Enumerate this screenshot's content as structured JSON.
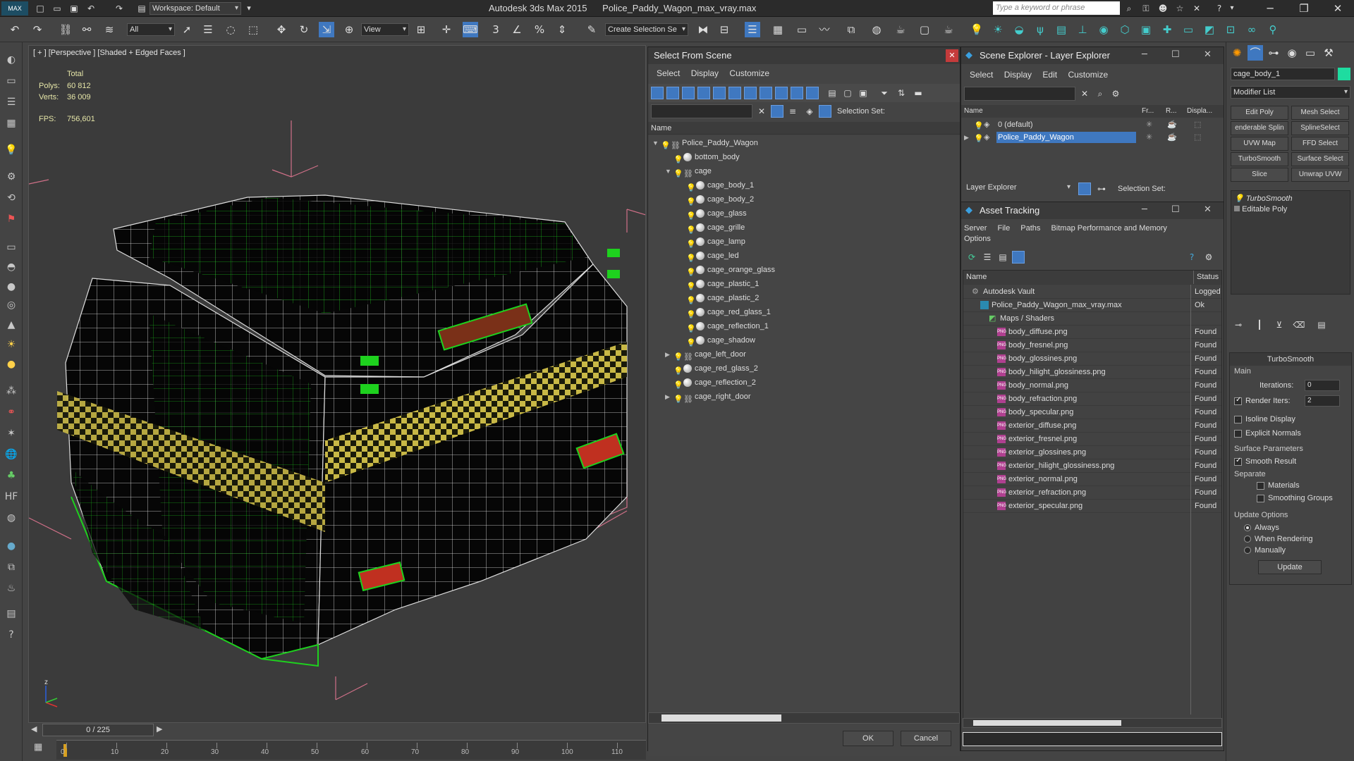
{
  "app": {
    "title": "Autodesk 3ds Max  2015",
    "file": "Police_Paddy_Wagon_max_vray.max",
    "workspace": "Workspace: Default",
    "search_placeholder": "Type a keyword or phrase",
    "logo": "MAX"
  },
  "toolbar": {
    "filter": "All",
    "ref_coord": "View",
    "selection_set": "Create Selection Se",
    "snap_3": "3",
    "snap_pct": "%"
  },
  "viewport": {
    "label": "[ + ] [Perspective ] [Shaded + Edged Faces ]",
    "stats_header": "Total",
    "polys_label": "Polys:",
    "polys_value": "60 812",
    "verts_label": "Verts:",
    "verts_value": "36 009",
    "fps_label": "FPS:",
    "fps_value": "756,601",
    "axis_z": "z"
  },
  "timeline": {
    "frame": "0 / 225",
    "ticks": [
      "0",
      "10",
      "20",
      "30",
      "40",
      "50",
      "60",
      "70",
      "80",
      "90",
      "100",
      "110"
    ]
  },
  "select_from_scene": {
    "title": "Select From Scene",
    "menus": [
      "Select",
      "Display",
      "Customize"
    ],
    "selection_set_label": "Selection Set:",
    "column_name": "Name",
    "rows": [
      {
        "label": "Police_Paddy_Wagon",
        "level": 0,
        "expand": "▼",
        "icon": "group"
      },
      {
        "label": "bottom_body",
        "level": 1,
        "expand": "",
        "icon": "sphere"
      },
      {
        "label": "cage",
        "level": 1,
        "expand": "▼",
        "icon": "group"
      },
      {
        "label": "cage_body_1",
        "level": 2,
        "expand": "",
        "icon": "sphere"
      },
      {
        "label": "cage_body_2",
        "level": 2,
        "expand": "",
        "icon": "sphere"
      },
      {
        "label": "cage_glass",
        "level": 2,
        "expand": "",
        "icon": "sphere"
      },
      {
        "label": "cage_grille",
        "level": 2,
        "expand": "",
        "icon": "sphere"
      },
      {
        "label": "cage_lamp",
        "level": 2,
        "expand": "",
        "icon": "sphere"
      },
      {
        "label": "cage_led",
        "level": 2,
        "expand": "",
        "icon": "sphere"
      },
      {
        "label": "cage_orange_glass",
        "level": 2,
        "expand": "",
        "icon": "sphere"
      },
      {
        "label": "cage_plastic_1",
        "level": 2,
        "expand": "",
        "icon": "sphere"
      },
      {
        "label": "cage_plastic_2",
        "level": 2,
        "expand": "",
        "icon": "sphere"
      },
      {
        "label": "cage_red_glass_1",
        "level": 2,
        "expand": "",
        "icon": "sphere"
      },
      {
        "label": "cage_reflection_1",
        "level": 2,
        "expand": "",
        "icon": "sphere"
      },
      {
        "label": "cage_shadow",
        "level": 2,
        "expand": "",
        "icon": "sphere"
      },
      {
        "label": "cage_left_door",
        "level": 1,
        "expand": "▶",
        "icon": "group"
      },
      {
        "label": "cage_red_glass_2",
        "level": 1,
        "expand": "",
        "icon": "sphere"
      },
      {
        "label": "cage_reflection_2",
        "level": 1,
        "expand": "",
        "icon": "sphere"
      },
      {
        "label": "cage_right_door",
        "level": 1,
        "expand": "▶",
        "icon": "group"
      }
    ],
    "ok": "OK",
    "cancel": "Cancel"
  },
  "scene_explorer": {
    "title": "Scene Explorer - Layer Explorer",
    "menus": [
      "Select",
      "Display",
      "Edit",
      "Customize"
    ],
    "columns": [
      "Name",
      "Fr...",
      "R...",
      "Displa..."
    ],
    "rows": [
      {
        "label": "0 (default)",
        "selected": false
      },
      {
        "label": "Police_Paddy_Wagon",
        "selected": true
      }
    ],
    "footer_dropdown": "Layer Explorer",
    "selection_set_label": "Selection Set:"
  },
  "asset_tracking": {
    "title": "Asset Tracking",
    "menus": [
      "Server",
      "File",
      "Paths",
      "Bitmap Performance and Memory"
    ],
    "menu_options": "Options",
    "col_name": "Name",
    "col_status": "Status",
    "rows": [
      {
        "name": "Autodesk Vault",
        "status": "Logged",
        "indent": 1,
        "icon": "vault"
      },
      {
        "name": "Police_Paddy_Wagon_max_vray.max",
        "status": "Ok",
        "indent": 2,
        "icon": "max"
      },
      {
        "name": "Maps / Shaders",
        "status": "",
        "indent": 3,
        "icon": "maps"
      },
      {
        "name": "body_diffuse.png",
        "status": "Found",
        "indent": 4,
        "icon": "png"
      },
      {
        "name": "body_fresnel.png",
        "status": "Found",
        "indent": 4,
        "icon": "png"
      },
      {
        "name": "body_glossines.png",
        "status": "Found",
        "indent": 4,
        "icon": "png"
      },
      {
        "name": "body_hilight_glossiness.png",
        "status": "Found",
        "indent": 4,
        "icon": "png"
      },
      {
        "name": "body_normal.png",
        "status": "Found",
        "indent": 4,
        "icon": "png"
      },
      {
        "name": "body_refraction.png",
        "status": "Found",
        "indent": 4,
        "icon": "png"
      },
      {
        "name": "body_specular.png",
        "status": "Found",
        "indent": 4,
        "icon": "png"
      },
      {
        "name": "exterior_diffuse.png",
        "status": "Found",
        "indent": 4,
        "icon": "png"
      },
      {
        "name": "exterior_fresnel.png",
        "status": "Found",
        "indent": 4,
        "icon": "png"
      },
      {
        "name": "exterior_glossines.png",
        "status": "Found",
        "indent": 4,
        "icon": "png"
      },
      {
        "name": "exterior_hilight_glossiness.png",
        "status": "Found",
        "indent": 4,
        "icon": "png"
      },
      {
        "name": "exterior_normal.png",
        "status": "Found",
        "indent": 4,
        "icon": "png"
      },
      {
        "name": "exterior_refraction.png",
        "status": "Found",
        "indent": 4,
        "icon": "png"
      },
      {
        "name": "exterior_specular.png",
        "status": "Found",
        "indent": 4,
        "icon": "png"
      }
    ]
  },
  "command_panel": {
    "object_name": "cage_body_1",
    "modifier_list": "Modifier List",
    "buttons": [
      "Edit Poly",
      "Mesh Select",
      "enderable Splin",
      "SplineSelect",
      "UVW Map",
      "FFD Select",
      "TurboSmooth",
      "Surface Select",
      "Slice",
      "Unwrap UVW"
    ],
    "stack": [
      "TurboSmooth",
      "Editable Poly"
    ],
    "rollout_title": "TurboSmooth",
    "main_label": "Main",
    "iterations_label": "Iterations:",
    "iterations_value": "0",
    "render_iters_label": "Render Iters:",
    "render_iters_value": "2",
    "isoline": "Isoline Display",
    "explicit_normals": "Explicit Normals",
    "surface_params": "Surface Parameters",
    "smooth_result": "Smooth Result",
    "separate": "Separate",
    "materials": "Materials",
    "smoothing_groups": "Smoothing Groups",
    "update_options": "Update Options",
    "always": "Always",
    "when_rendering": "When Rendering",
    "manually": "Manually",
    "update": "Update"
  }
}
